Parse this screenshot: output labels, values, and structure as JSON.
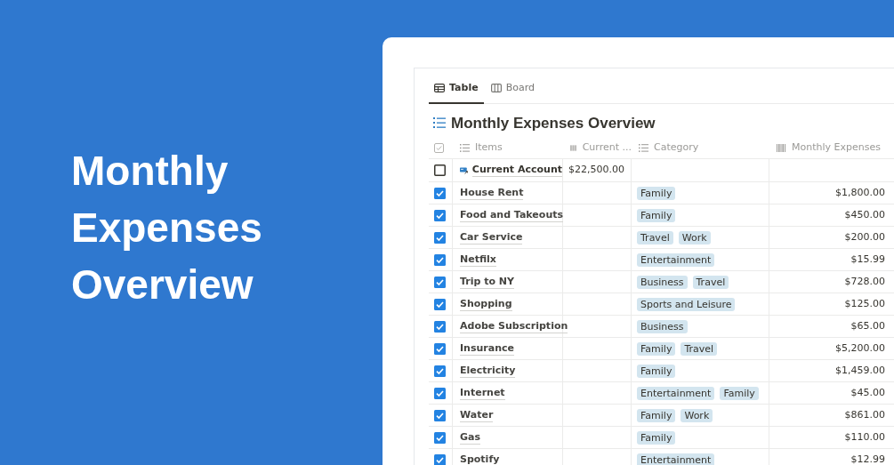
{
  "headline": [
    "Monthly",
    "Expenses",
    "Overview"
  ],
  "tabs": [
    {
      "label": "Table",
      "kind": "table",
      "selected": true
    },
    {
      "label": "Board",
      "kind": "board",
      "selected": false
    }
  ],
  "table": {
    "title": "Monthly Expenses Overview",
    "columns": [
      {
        "kind": "checkbox"
      },
      {
        "label": "Items",
        "kind": "list"
      },
      {
        "label": "Current ...",
        "kind": "number"
      },
      {
        "label": "Category",
        "kind": "list"
      },
      {
        "label": "Monthly Expenses",
        "kind": "number"
      }
    ],
    "rows": [
      {
        "kind": "account",
        "checked": false,
        "item": "Current Account",
        "current": "$22,500.00",
        "categories": [],
        "monthly": ""
      },
      {
        "kind": "expense",
        "checked": true,
        "item": "House Rent",
        "categories": [
          "Family"
        ],
        "monthly": "$1,800.00"
      },
      {
        "kind": "expense",
        "checked": true,
        "item": "Food and Takeouts",
        "categories": [
          "Family"
        ],
        "monthly": "$450.00"
      },
      {
        "kind": "expense",
        "checked": true,
        "item": "Car Service",
        "categories": [
          "Travel",
          "Work"
        ],
        "monthly": "$200.00"
      },
      {
        "kind": "expense",
        "checked": true,
        "item": "Netfilx",
        "categories": [
          "Entertainment"
        ],
        "monthly": "$15.99"
      },
      {
        "kind": "expense",
        "checked": true,
        "item": "Trip to NY",
        "categories": [
          "Business",
          "Travel"
        ],
        "monthly": "$728.00"
      },
      {
        "kind": "expense",
        "checked": true,
        "item": "Shopping",
        "categories": [
          "Sports and Leisure"
        ],
        "monthly": "$125.00"
      },
      {
        "kind": "expense",
        "checked": true,
        "item": "Adobe Subscription",
        "categories": [
          "Business"
        ],
        "monthly": "$65.00"
      },
      {
        "kind": "expense",
        "checked": true,
        "item": "Insurance",
        "categories": [
          "Family",
          "Travel"
        ],
        "monthly": "$5,200.00"
      },
      {
        "kind": "expense",
        "checked": true,
        "item": "Electricity",
        "categories": [
          "Family"
        ],
        "monthly": "$1,459.00"
      },
      {
        "kind": "expense",
        "checked": true,
        "item": "Internet",
        "categories": [
          "Entertainment",
          "Family"
        ],
        "monthly": "$45.00"
      },
      {
        "kind": "expense",
        "checked": true,
        "item": "Water",
        "categories": [
          "Family",
          "Work"
        ],
        "monthly": "$861.00"
      },
      {
        "kind": "expense",
        "checked": true,
        "item": "Gas",
        "categories": [
          "Family"
        ],
        "monthly": "$110.00"
      },
      {
        "kind": "expense",
        "checked": true,
        "item": "Spotify",
        "categories": [
          "Entertainment"
        ],
        "monthly": "$12.99"
      }
    ]
  }
}
